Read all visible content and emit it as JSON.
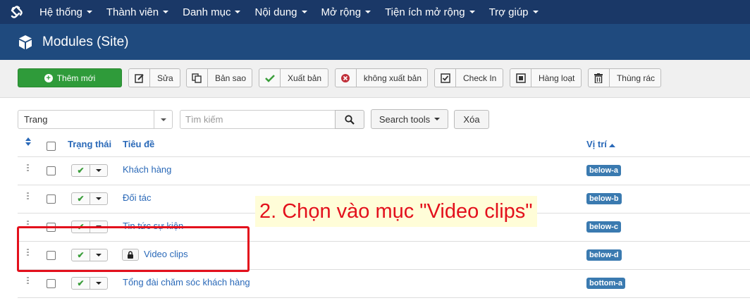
{
  "topnav": {
    "logo_icon": "joomla-logo-icon",
    "items": [
      {
        "label": "Hệ thống"
      },
      {
        "label": "Thành viên"
      },
      {
        "label": "Danh mục"
      },
      {
        "label": "Nội dung"
      },
      {
        "label": "Mở rộng"
      },
      {
        "label": "Tiện ích mở rộng"
      },
      {
        "label": "Trợ giúp"
      }
    ]
  },
  "header": {
    "icon": "cube-icon",
    "title": "Modules (Site)"
  },
  "toolbar": {
    "new": "Thêm mới",
    "edit": "Sửa",
    "copy": "Bản sao",
    "publish": "Xuất bản",
    "unpublish": "không xuất bản",
    "checkin": "Check In",
    "batch": "Hàng loạt",
    "trash": "Thùng rác"
  },
  "filters": {
    "client_select": "Trang",
    "search_placeholder": "Tìm kiếm",
    "search_tools": "Search tools",
    "clear": "Xóa"
  },
  "table": {
    "headers": {
      "status": "Trạng thái",
      "title": "Tiêu đề",
      "position": "Vị trí"
    },
    "rows": [
      {
        "title": "Khách hàng",
        "position": "below-a",
        "locked": false
      },
      {
        "title": "Đối tác",
        "position": "below-b",
        "locked": false
      },
      {
        "title": "Tin tức sự kiện",
        "position": "below-c",
        "locked": false
      },
      {
        "title": "Video clips",
        "position": "below-d",
        "locked": true
      },
      {
        "title": "Tổng đài chăm sóc khách hàng",
        "position": "bottom-a",
        "locked": false
      }
    ]
  },
  "annotation": {
    "text": "2. Chọn vào mục \"Video clips\"",
    "color": "#e3101c"
  },
  "colors": {
    "nav": "#1a3867",
    "header": "#1f4a7e",
    "new_button": "#2f9b3a",
    "link": "#2a69b8",
    "badge": "#3a7ab0"
  }
}
